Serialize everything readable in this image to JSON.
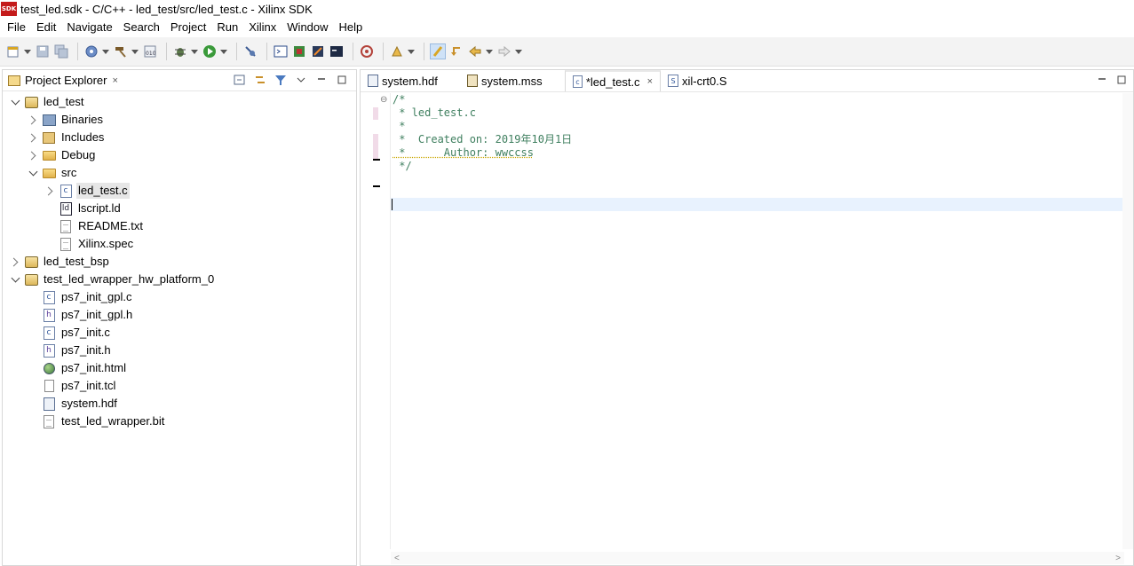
{
  "window": {
    "app_icon_text": "SDK",
    "title": "test_led.sdk - C/C++ - led_test/src/led_test.c - Xilinx SDK"
  },
  "menu": [
    "File",
    "Edit",
    "Navigate",
    "Search",
    "Project",
    "Run",
    "Xilinx",
    "Window",
    "Help"
  ],
  "explorer": {
    "tab_label": "Project Explorer",
    "close_glyph": "×"
  },
  "tree": [
    {
      "label": "led_test",
      "icon": "project-icon",
      "level": 0,
      "twisty": "open"
    },
    {
      "label": "Binaries",
      "icon": "binaries-icon",
      "level": 1,
      "twisty": "closed"
    },
    {
      "label": "Includes",
      "icon": "includes-icon",
      "level": 1,
      "twisty": "closed"
    },
    {
      "label": "Debug",
      "icon": "folder-icon",
      "level": 1,
      "twisty": "closed"
    },
    {
      "label": "src",
      "icon": "folder-icon",
      "level": 1,
      "twisty": "open"
    },
    {
      "label": "led_test.c",
      "icon": "c-file-icon",
      "level": 2,
      "twisty": "closed",
      "selected": true
    },
    {
      "label": "lscript.ld",
      "icon": "linker-script-icon",
      "level": 2,
      "twisty": "none"
    },
    {
      "label": "README.txt",
      "icon": "text-file-icon",
      "level": 2,
      "twisty": "none"
    },
    {
      "label": "Xilinx.spec",
      "icon": "text-file-icon",
      "level": 2,
      "twisty": "none"
    },
    {
      "label": "led_test_bsp",
      "icon": "bsp-project-icon",
      "level": 0,
      "twisty": "closed"
    },
    {
      "label": "test_led_wrapper_hw_platform_0",
      "icon": "hw-project-icon",
      "level": 0,
      "twisty": "open"
    },
    {
      "label": "ps7_init_gpl.c",
      "icon": "c-file-icon",
      "level": 1,
      "twisty": "none"
    },
    {
      "label": "ps7_init_gpl.h",
      "icon": "h-file-icon",
      "level": 1,
      "twisty": "none"
    },
    {
      "label": "ps7_init.c",
      "icon": "c-file-icon",
      "level": 1,
      "twisty": "none"
    },
    {
      "label": "ps7_init.h",
      "icon": "h-file-icon",
      "level": 1,
      "twisty": "none"
    },
    {
      "label": "ps7_init.html",
      "icon": "html-globe-icon",
      "level": 1,
      "twisty": "none"
    },
    {
      "label": "ps7_init.tcl",
      "icon": "blank-file-icon",
      "level": 1,
      "twisty": "none"
    },
    {
      "label": "system.hdf",
      "icon": "hdf-file-icon",
      "level": 1,
      "twisty": "none"
    },
    {
      "label": "test_led_wrapper.bit",
      "icon": "text-file-icon",
      "level": 1,
      "twisty": "none"
    }
  ],
  "editor_tabs": [
    {
      "label": "system.hdf",
      "icon": "hdf-file-icon",
      "active": false
    },
    {
      "label": "system.mss",
      "icon": "mss-file-icon",
      "active": false
    },
    {
      "label": "*led_test.c",
      "icon": "c-file-icon",
      "active": true
    },
    {
      "label": "xil-crt0.S",
      "icon": "asm-file-icon",
      "active": false
    }
  ],
  "code_lines": [
    "/*",
    " * led_test.c",
    " *",
    " *  Created on: 2019年10月1日",
    " *      Author: wwccss",
    " */",
    "",
    "",
    ""
  ],
  "colors": {
    "comment": "#3f7f5f",
    "current_line": "#e8f2fe",
    "selection": "#e6e6e6"
  }
}
